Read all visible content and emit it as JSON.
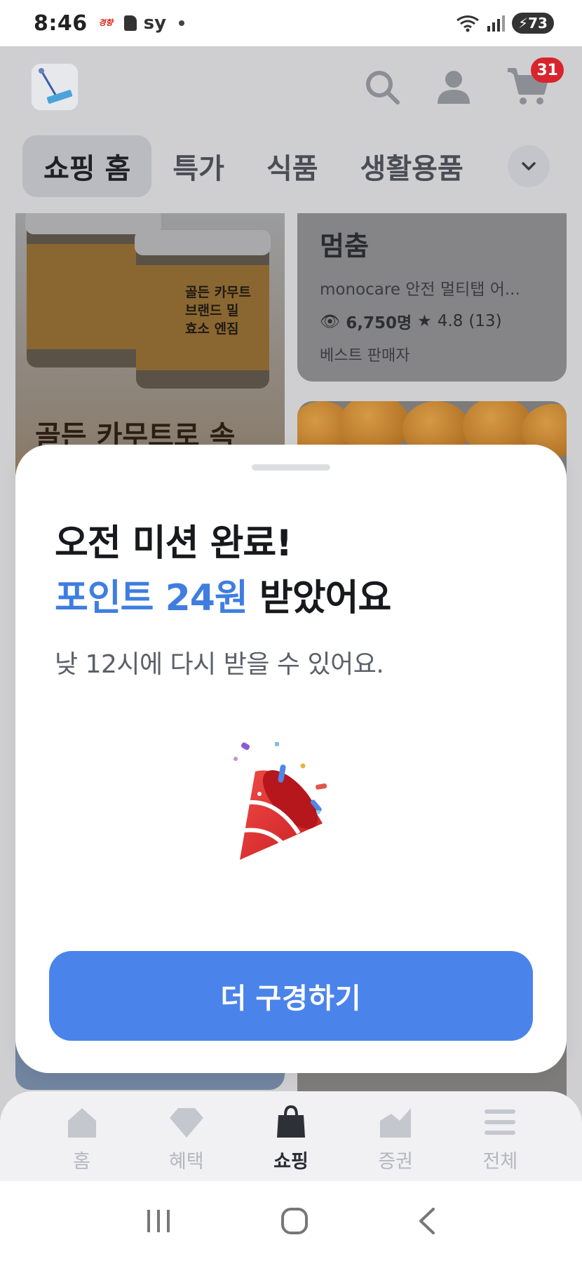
{
  "status_bar": {
    "time": "8:46",
    "notif_text": "sy",
    "battery": "73"
  },
  "header": {
    "cart_count": "31",
    "icons": [
      "app-logo",
      "search-icon",
      "user-icon",
      "cart-icon"
    ]
  },
  "tabs": [
    {
      "label": "쇼핑 홈",
      "active": true
    },
    {
      "label": "특가",
      "active": false
    },
    {
      "label": "식품",
      "active": false
    },
    {
      "label": "생활용품",
      "active": false
    }
  ],
  "feed": {
    "left_card": {
      "jar_text": "골든 카무트\n브랜드 밀\n효소 엔짐",
      "promo": "골든 카무트로 속"
    },
    "right_card": {
      "title": "멈춤",
      "subtitle": "monocare 안전 멀티탭 어...",
      "views": "6,750명",
      "rating": "4.8",
      "reviews": "(13)",
      "seller": "베스트 판매자"
    }
  },
  "sheet": {
    "title_line1": "오전 미션 완료!",
    "title_highlight": "포인트 24원",
    "title_line2_suffix": " 받았어요",
    "description": "낮 12시에 다시 받을 수 있어요.",
    "cta_label": "더 구경하기",
    "accent_color": "#3f7ee0",
    "button_color": "#4a84ea"
  },
  "bottom_nav": [
    {
      "label": "홈",
      "icon": "home-icon",
      "active": false
    },
    {
      "label": "혜택",
      "icon": "diamond-icon",
      "active": false
    },
    {
      "label": "쇼핑",
      "icon": "shopping-bag-icon",
      "active": true
    },
    {
      "label": "증권",
      "icon": "chart-icon",
      "active": false
    },
    {
      "label": "전체",
      "icon": "menu-icon",
      "active": false
    }
  ]
}
